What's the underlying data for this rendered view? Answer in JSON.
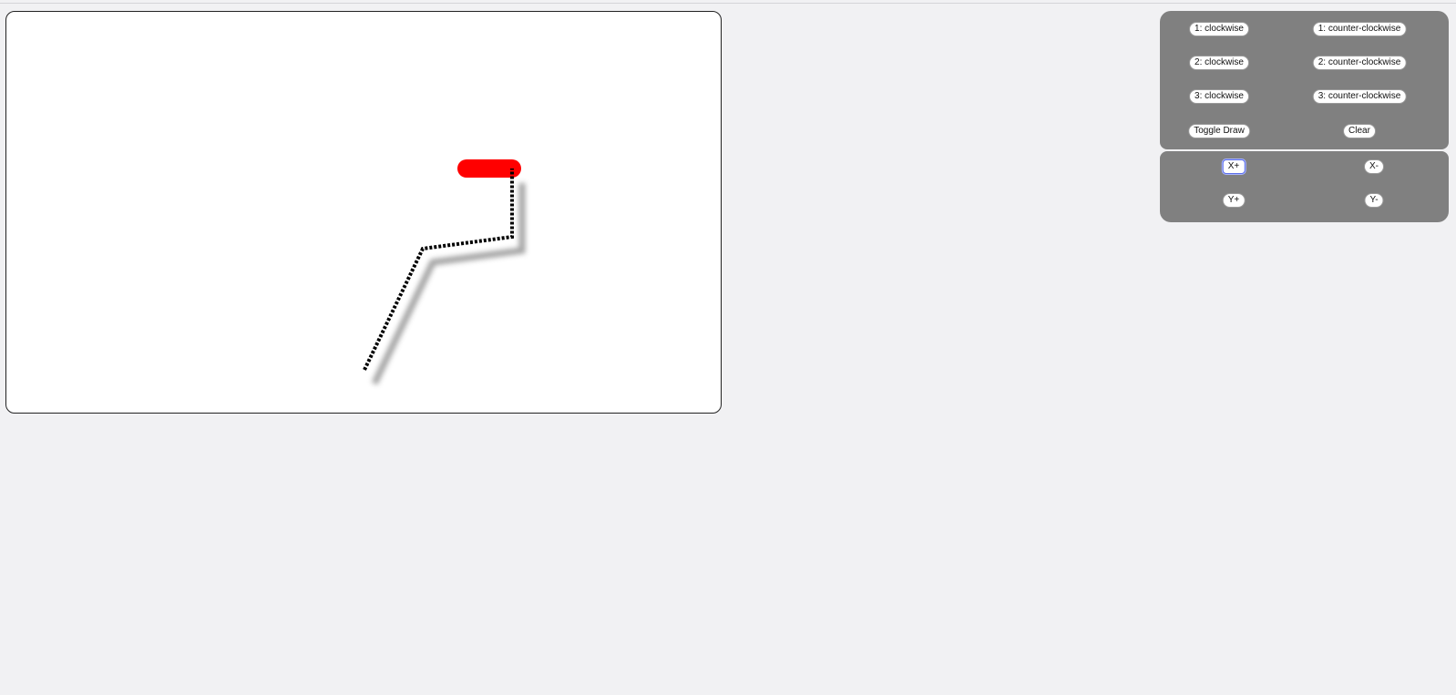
{
  "rotation_controls": {
    "joint1_cw": "1: clockwise",
    "joint1_ccw": "1: counter-clockwise",
    "joint2_cw": "2: clockwise",
    "joint2_ccw": "2: counter-clockwise",
    "joint3_cw": "3: clockwise",
    "joint3_ccw": "3: counter-clockwise",
    "toggle_draw": "Toggle Draw",
    "clear": "Clear"
  },
  "move_controls": {
    "x_plus": "X+",
    "x_minus": "X-",
    "y_plus": "Y+",
    "y_minus": "Y-"
  },
  "colors": {
    "end_effector": "#ff0000",
    "arm_line": "#000000",
    "panel_bg": "#808080"
  }
}
